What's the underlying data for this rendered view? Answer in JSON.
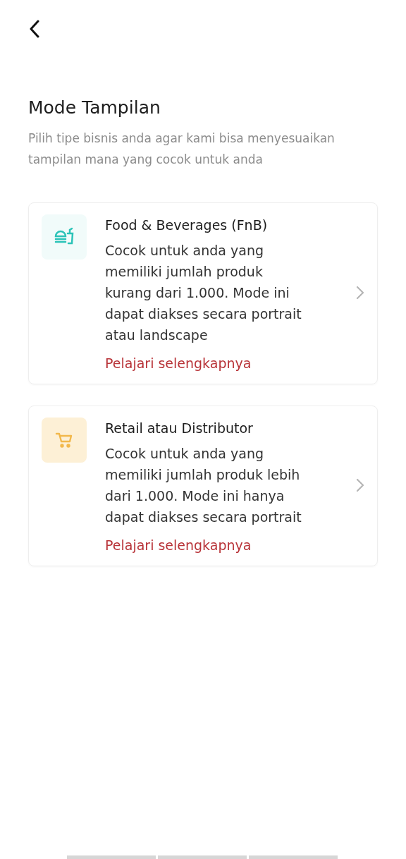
{
  "title": "Mode Tampilan",
  "subtitle": "Pilih tipe bisnis anda agar kami bisa menyesuaikan tampilan mana yang cocok untuk anda",
  "modes": [
    {
      "kind": "food",
      "name": "Food & Beverages (FnB)",
      "description": "Cocok untuk anda yang memiliki jumlah produk kurang dari 1.000. Mode ini dapat diakses secara portrait atau landscape",
      "link": "Pelajari selengkapnya"
    },
    {
      "kind": "retail",
      "name": "Retail atau Distributor",
      "description": "Cocok untuk anda yang memiliki jumlah produk lebih dari 1.000. Mode ini hanya dapat diakses secara portrait",
      "link": "Pelajari selengkapnya"
    }
  ]
}
